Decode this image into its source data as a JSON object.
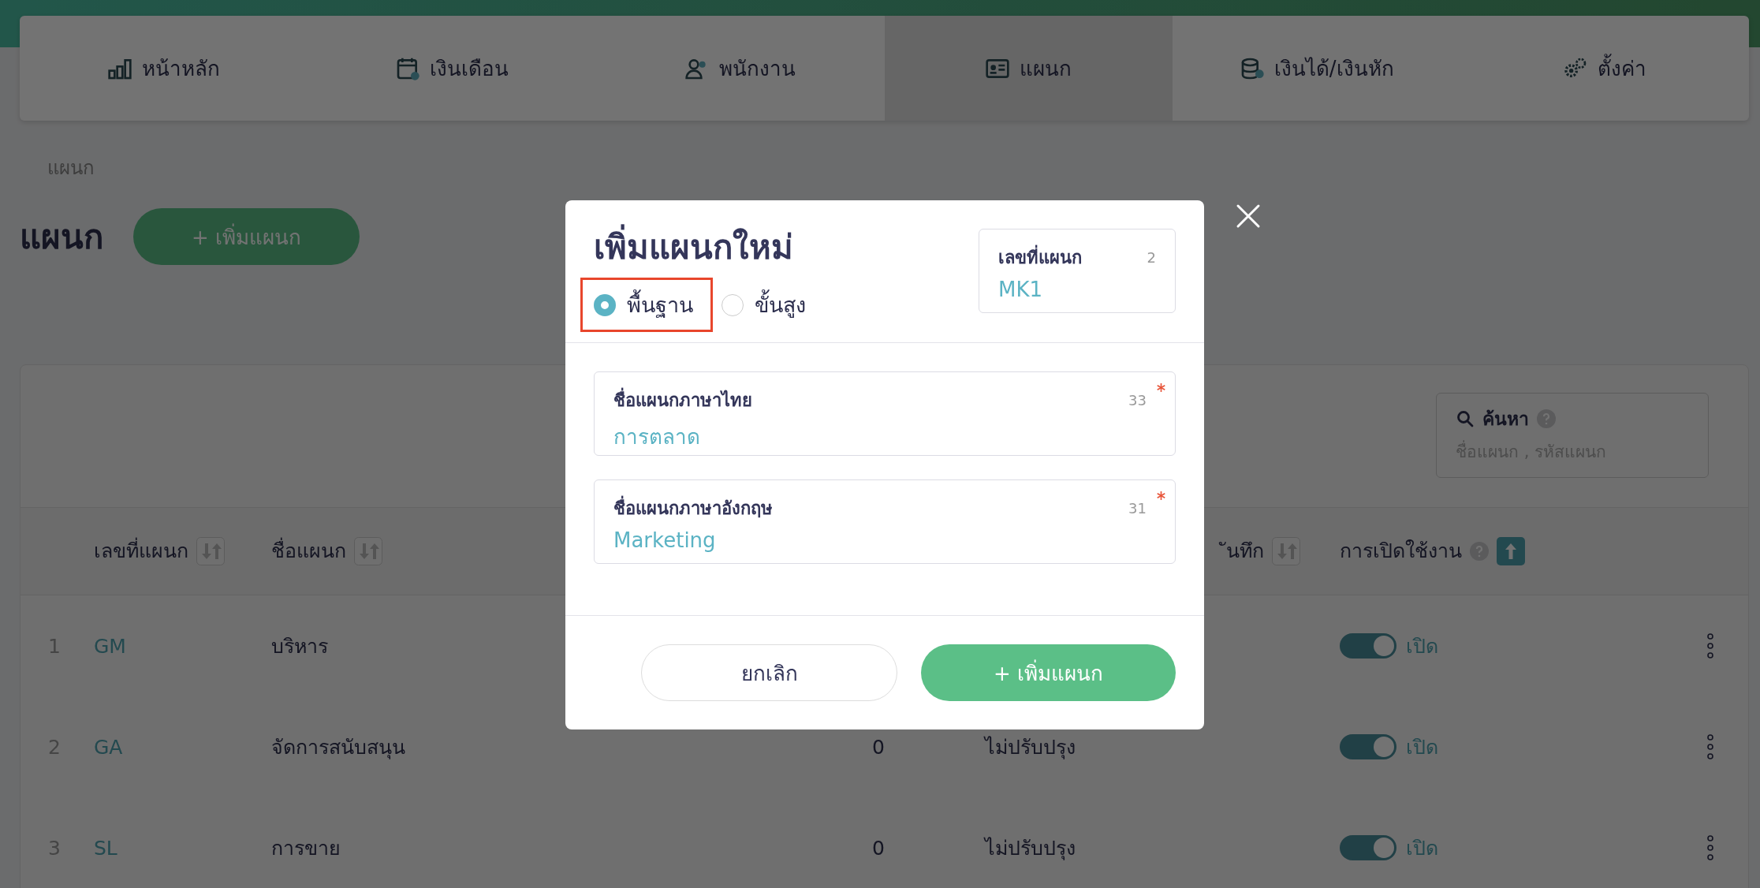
{
  "nav_tabs": [
    {
      "label": "หน้าหลัก",
      "selected": false
    },
    {
      "label": "เงินเดือน",
      "selected": false
    },
    {
      "label": "พนักงาน",
      "selected": false
    },
    {
      "label": "แผนก",
      "selected": true
    },
    {
      "label": "เงินได้/เงินหัก",
      "selected": false
    },
    {
      "label": "ตั้งค่า",
      "selected": false
    }
  ],
  "breadcrumb": "แผนก",
  "page_title": "แผนก",
  "add_button": "+ เพิ่มแผนก",
  "search": {
    "label": "ค้นหา",
    "placeholder": "ชื่อแผนก , รหัสแผนก"
  },
  "table": {
    "columns": [
      {
        "label": "เลขที่แผนก",
        "sort_active": false,
        "help": false
      },
      {
        "label": "ชื่อแผนก",
        "sort_active": false,
        "help": false
      },
      {
        "label": "ันทึก",
        "sort_active": false,
        "help": false
      },
      {
        "label": "การเปิดใช้งาน",
        "sort_active": true,
        "help": true
      }
    ],
    "rows": [
      {
        "index": "1",
        "code": "GM",
        "name": "บริหาร",
        "on": true,
        "status": "เปิด"
      },
      {
        "index": "2",
        "code": "GA",
        "name": "จัดการสนับสนุน",
        "column_3": "0",
        "column_4": "ไม่ปรับปรุง",
        "on": true,
        "status": "เปิด"
      },
      {
        "index": "3",
        "code": "SL",
        "name": "การขาย",
        "column_3": "0",
        "column_4": "ไม่ปรับปรุง",
        "on": true,
        "status": "เปิด"
      }
    ]
  },
  "modal": {
    "title": "เพิ่มแผนกใหม่",
    "modes": [
      {
        "label": "พื้นฐาน",
        "selected": true,
        "highlighted": true
      },
      {
        "label": "ขั้นสูง",
        "selected": false,
        "highlighted": false
      }
    ],
    "code_field": {
      "label": "เลขที่แผนก",
      "counter": "2",
      "value": "MK1"
    },
    "fields": [
      {
        "label": "ชื่อแผนกภาษาไทย",
        "counter": "33",
        "required": true,
        "value": "การตลาด"
      },
      {
        "label": "ชื่อแผนกภาษาอังกฤษ",
        "counter": "31",
        "required": true,
        "value": "Marketing"
      }
    ],
    "cancel_button": "ยกเลิก",
    "submit_button": "+ เพิ่มแผนก"
  }
}
